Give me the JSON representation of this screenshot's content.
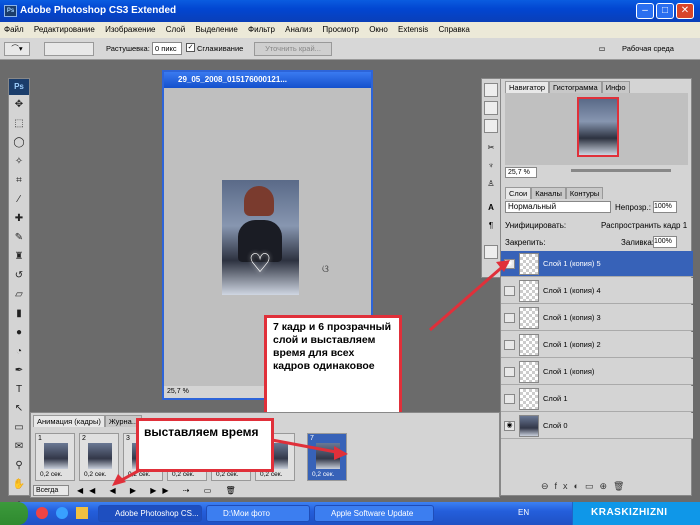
{
  "window": {
    "title": "Adobe Photoshop CS3 Extended",
    "ps_badge": "Ps"
  },
  "menu": [
    "Файл",
    "Редактирование",
    "Изображение",
    "Слой",
    "Выделение",
    "Фильтр",
    "Анализ",
    "Просмотр",
    "Окно",
    "Extensis",
    "Справка"
  ],
  "options": {
    "feather_label": "Растушевка:",
    "feather_value": "0 пикс",
    "antialias_label": "Сглаживание",
    "refine_label": "Уточнить край...",
    "workspace_label": "Рабочая среда"
  },
  "document": {
    "title": "29_05_2008_015176000121...",
    "zoom": "25,7 %"
  },
  "navigator": {
    "tabs": [
      "Навигатор",
      "Гистограмма",
      "Инфо"
    ],
    "zoom": "25,7 %"
  },
  "layers_panel": {
    "tabs": [
      "Слои",
      "Каналы",
      "Контуры"
    ],
    "blend_mode": "Нормальный",
    "opacity_label": "Непрозр.:",
    "opacity_value": "100%",
    "unify_label": "Унифицировать:",
    "propagate_label": "Распространить кадр 1",
    "lock_label": "Закрепить:",
    "fill_label": "Заливка:",
    "fill_value": "100%",
    "layers": [
      {
        "name": "Слой 1 (копия) 5",
        "selected": true,
        "visible": true
      },
      {
        "name": "Слой 1 (копия) 4",
        "selected": false,
        "visible": false
      },
      {
        "name": "Слой 1 (копия) 3",
        "selected": false,
        "visible": false
      },
      {
        "name": "Слой 1 (копия) 2",
        "selected": false,
        "visible": false
      },
      {
        "name": "Слой 1 (копия)",
        "selected": false,
        "visible": false
      },
      {
        "name": "Слой 1",
        "selected": false,
        "visible": false
      },
      {
        "name": "Слой 0",
        "selected": false,
        "visible": true
      }
    ]
  },
  "animation": {
    "tabs": [
      "Анимация (кадры)",
      "Журна..."
    ],
    "loop_label": "Всегда",
    "frames": [
      {
        "num": "1",
        "time": "0,2 сек."
      },
      {
        "num": "2",
        "time": "0,2 сек."
      },
      {
        "num": "3",
        "time": "0,2 сек."
      },
      {
        "num": "4",
        "time": "0,2 сек."
      },
      {
        "num": "5",
        "time": "0,2 сек."
      },
      {
        "num": "6",
        "time": "0,2 сек."
      },
      {
        "num": "7",
        "time": "0,2 сек."
      }
    ]
  },
  "callouts": {
    "frame7": "7 кадр и 6 прозрачный слой и выставляем время для всех кадров одинаковое",
    "time": "выставляем время"
  },
  "taskbar": {
    "tasks": [
      "Adobe Photoshop CS...",
      "D:\\Мои фото",
      "Apple Software Update"
    ],
    "lang": "EN",
    "watermark": "KRASKIZHIZNI"
  },
  "colors": {
    "accent": "#3762b8",
    "callout_border": "#e0303a",
    "arrow": "#e0303a"
  }
}
